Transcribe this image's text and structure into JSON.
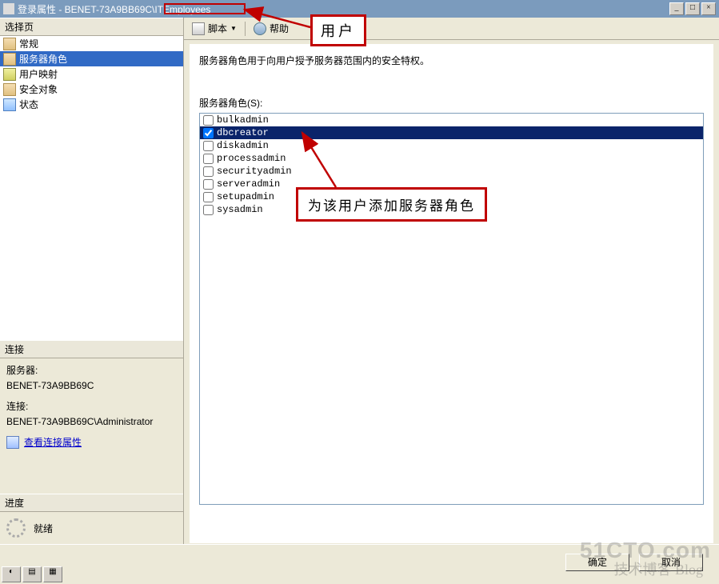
{
  "titlebar": {
    "text": "登录属性 - BENET-73A9BB69C\\ITEmployees"
  },
  "leftcol": {
    "select_header": "选择页",
    "nav": [
      {
        "label": "常规",
        "selected": false
      },
      {
        "label": "服务器角色",
        "selected": true
      },
      {
        "label": "用户映射",
        "selected": false
      },
      {
        "label": "安全对象",
        "selected": false
      },
      {
        "label": "状态",
        "selected": false
      }
    ],
    "conn_header": "连接",
    "server_label": "服务器:",
    "server_value": "BENET-73A9BB69C",
    "conn_label": "连接:",
    "conn_value": "BENET-73A9BB69C\\Administrator",
    "view_conn_link": "查看连接属性",
    "progress_header": "进度",
    "progress_status": "就绪"
  },
  "toolbar": {
    "script_label": "脚本",
    "help_label": "帮助"
  },
  "content": {
    "description": "服务器角色用于向用户授予服务器范围内的安全特权。",
    "list_label": "服务器角色(S):",
    "roles": [
      {
        "name": "bulkadmin",
        "checked": false,
        "selected": false
      },
      {
        "name": "dbcreator",
        "checked": true,
        "selected": true
      },
      {
        "name": "diskadmin",
        "checked": false,
        "selected": false
      },
      {
        "name": "processadmin",
        "checked": false,
        "selected": false
      },
      {
        "name": "securityadmin",
        "checked": false,
        "selected": false
      },
      {
        "name": "serveradmin",
        "checked": false,
        "selected": false
      },
      {
        "name": "setupadmin",
        "checked": false,
        "selected": false
      },
      {
        "name": "sysadmin",
        "checked": false,
        "selected": false
      }
    ]
  },
  "buttons": {
    "ok": "确定",
    "cancel": "取消"
  },
  "annotations": {
    "user_box": "用户",
    "add_role_box": "为该用户添加服务器角色"
  },
  "watermark": {
    "line1": "51CTO.com",
    "line2": "技术博客  Blog"
  }
}
